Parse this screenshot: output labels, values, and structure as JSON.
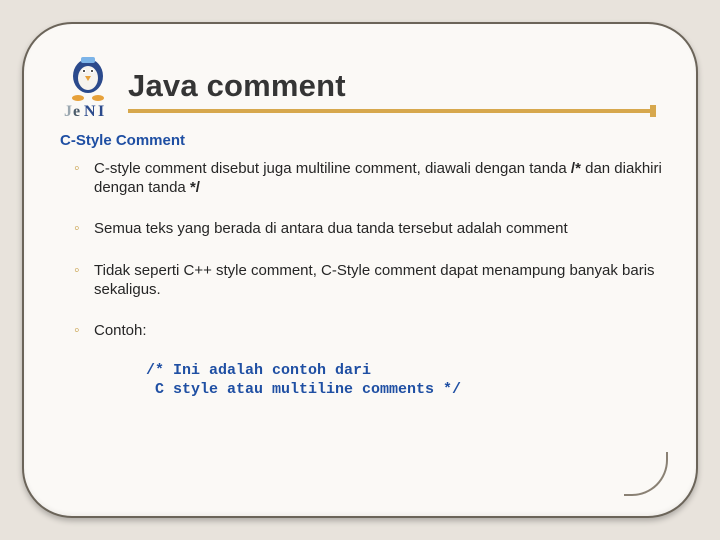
{
  "title": "Java comment",
  "subtitle": "C-Style Comment",
  "bullets": [
    {
      "pre": "C-style comment disebut juga multiline comment, diawali dengan tanda ",
      "b1": "/*",
      "mid": " dan diakhiri dengan tanda ",
      "b2": "*/"
    },
    {
      "text": "Semua teks yang berada di antara dua tanda tersebut adalah comment"
    },
    {
      "text": "Tidak seperti C++ style comment, C-Style comment dapat menampung banyak baris sekaligus."
    },
    {
      "text": "Contoh:"
    }
  ],
  "code": "/* Ini adalah contoh dari\n C style atau multiline comments */",
  "logo_alt": "JENI mascot logo"
}
